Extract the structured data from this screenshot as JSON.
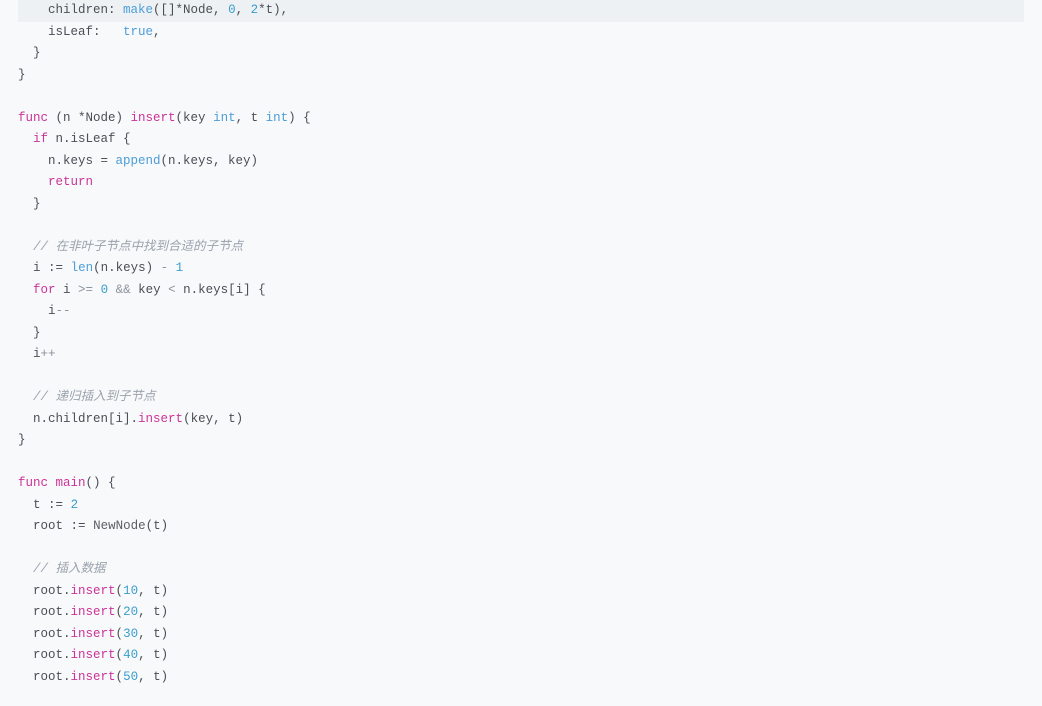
{
  "code": {
    "lines": [
      {
        "indent": 2,
        "cls": "highlight",
        "tokens": [
          {
            "t": "children: ",
            "c": "ident"
          },
          {
            "t": "make",
            "c": "builtin"
          },
          {
            "t": "([]*Node, ",
            "c": "ident"
          },
          {
            "t": "0",
            "c": "num"
          },
          {
            "t": ", ",
            "c": "ident"
          },
          {
            "t": "2",
            "c": "num"
          },
          {
            "t": "*t),",
            "c": "ident"
          }
        ]
      },
      {
        "indent": 2,
        "tokens": [
          {
            "t": "isLeaf:   ",
            "c": "ident"
          },
          {
            "t": "true",
            "c": "typ"
          },
          {
            "t": ",",
            "c": "ident"
          }
        ]
      },
      {
        "indent": 1,
        "tokens": [
          {
            "t": "}",
            "c": "ident"
          }
        ]
      },
      {
        "indent": 0,
        "tokens": [
          {
            "t": "}",
            "c": "ident"
          }
        ]
      },
      {
        "indent": 0,
        "tokens": []
      },
      {
        "indent": 0,
        "tokens": [
          {
            "t": "func",
            "c": "kw"
          },
          {
            "t": " (n *Node) ",
            "c": "ident"
          },
          {
            "t": "insert",
            "c": "method"
          },
          {
            "t": "(key ",
            "c": "ident"
          },
          {
            "t": "int",
            "c": "typ"
          },
          {
            "t": ", t ",
            "c": "ident"
          },
          {
            "t": "int",
            "c": "typ"
          },
          {
            "t": ") {",
            "c": "ident"
          }
        ]
      },
      {
        "indent": 1,
        "tokens": [
          {
            "t": "if",
            "c": "kw"
          },
          {
            "t": " n.isLeaf {",
            "c": "ident"
          }
        ]
      },
      {
        "indent": 2,
        "tokens": [
          {
            "t": "n.keys = ",
            "c": "ident"
          },
          {
            "t": "append",
            "c": "builtin"
          },
          {
            "t": "(n.keys, key)",
            "c": "ident"
          }
        ]
      },
      {
        "indent": 2,
        "tokens": [
          {
            "t": "return",
            "c": "kw"
          }
        ]
      },
      {
        "indent": 1,
        "tokens": [
          {
            "t": "}",
            "c": "ident"
          }
        ]
      },
      {
        "indent": 0,
        "tokens": []
      },
      {
        "indent": 1,
        "tokens": [
          {
            "t": "// 在非叶子节点中找到合适的子节点",
            "c": "cmt"
          }
        ]
      },
      {
        "indent": 1,
        "tokens": [
          {
            "t": "i ",
            "c": "ident"
          },
          {
            "t": ":=",
            "c": "op"
          },
          {
            "t": " ",
            "c": "ident"
          },
          {
            "t": "len",
            "c": "builtin"
          },
          {
            "t": "(n.keys) ",
            "c": "ident"
          },
          {
            "t": "-",
            "c": "oplight"
          },
          {
            "t": " ",
            "c": "ident"
          },
          {
            "t": "1",
            "c": "num"
          }
        ]
      },
      {
        "indent": 1,
        "tokens": [
          {
            "t": "for",
            "c": "kw"
          },
          {
            "t": " i ",
            "c": "ident"
          },
          {
            "t": ">=",
            "c": "oplight"
          },
          {
            "t": " ",
            "c": "ident"
          },
          {
            "t": "0",
            "c": "num"
          },
          {
            "t": " ",
            "c": "ident"
          },
          {
            "t": "&&",
            "c": "oplight"
          },
          {
            "t": " key ",
            "c": "ident"
          },
          {
            "t": "<",
            "c": "oplight"
          },
          {
            "t": " n.keys[i] {",
            "c": "ident"
          }
        ]
      },
      {
        "indent": 2,
        "tokens": [
          {
            "t": "i",
            "c": "ident"
          },
          {
            "t": "--",
            "c": "oplight"
          }
        ]
      },
      {
        "indent": 1,
        "tokens": [
          {
            "t": "}",
            "c": "ident"
          }
        ]
      },
      {
        "indent": 1,
        "tokens": [
          {
            "t": "i",
            "c": "ident"
          },
          {
            "t": "++",
            "c": "oplight"
          }
        ]
      },
      {
        "indent": 0,
        "tokens": []
      },
      {
        "indent": 1,
        "tokens": [
          {
            "t": "// 递归插入到子节点",
            "c": "cmt"
          }
        ]
      },
      {
        "indent": 1,
        "tokens": [
          {
            "t": "n.children[i].",
            "c": "ident"
          },
          {
            "t": "insert",
            "c": "method"
          },
          {
            "t": "(key, t)",
            "c": "ident"
          }
        ]
      },
      {
        "indent": 0,
        "tokens": [
          {
            "t": "}",
            "c": "ident"
          }
        ]
      },
      {
        "indent": 0,
        "tokens": []
      },
      {
        "indent": 0,
        "tokens": [
          {
            "t": "func",
            "c": "kw"
          },
          {
            "t": " ",
            "c": "ident"
          },
          {
            "t": "main",
            "c": "method"
          },
          {
            "t": "() {",
            "c": "ident"
          }
        ]
      },
      {
        "indent": 1,
        "tokens": [
          {
            "t": "t ",
            "c": "ident"
          },
          {
            "t": ":=",
            "c": "op"
          },
          {
            "t": " ",
            "c": "ident"
          },
          {
            "t": "2",
            "c": "num"
          }
        ]
      },
      {
        "indent": 1,
        "tokens": [
          {
            "t": "root ",
            "c": "ident"
          },
          {
            "t": ":=",
            "c": "op"
          },
          {
            "t": " ",
            "c": "ident"
          },
          {
            "t": "NewNode",
            "c": "newnode"
          },
          {
            "t": "(t)",
            "c": "ident"
          }
        ]
      },
      {
        "indent": 0,
        "tokens": []
      },
      {
        "indent": 1,
        "tokens": [
          {
            "t": "// 插入数据",
            "c": "cmt"
          }
        ]
      },
      {
        "indent": 1,
        "tokens": [
          {
            "t": "root.",
            "c": "ident"
          },
          {
            "t": "insert",
            "c": "method"
          },
          {
            "t": "(",
            "c": "ident"
          },
          {
            "t": "10",
            "c": "num"
          },
          {
            "t": ", t)",
            "c": "ident"
          }
        ]
      },
      {
        "indent": 1,
        "tokens": [
          {
            "t": "root.",
            "c": "ident"
          },
          {
            "t": "insert",
            "c": "method"
          },
          {
            "t": "(",
            "c": "ident"
          },
          {
            "t": "20",
            "c": "num"
          },
          {
            "t": ", t)",
            "c": "ident"
          }
        ]
      },
      {
        "indent": 1,
        "tokens": [
          {
            "t": "root.",
            "c": "ident"
          },
          {
            "t": "insert",
            "c": "method"
          },
          {
            "t": "(",
            "c": "ident"
          },
          {
            "t": "30",
            "c": "num"
          },
          {
            "t": ", t)",
            "c": "ident"
          }
        ]
      },
      {
        "indent": 1,
        "tokens": [
          {
            "t": "root.",
            "c": "ident"
          },
          {
            "t": "insert",
            "c": "method"
          },
          {
            "t": "(",
            "c": "ident"
          },
          {
            "t": "40",
            "c": "num"
          },
          {
            "t": ", t)",
            "c": "ident"
          }
        ]
      },
      {
        "indent": 1,
        "tokens": [
          {
            "t": "root.",
            "c": "ident"
          },
          {
            "t": "insert",
            "c": "method"
          },
          {
            "t": "(",
            "c": "ident"
          },
          {
            "t": "50",
            "c": "num"
          },
          {
            "t": ", t)",
            "c": "ident"
          }
        ]
      }
    ],
    "indentUnit": "  "
  }
}
